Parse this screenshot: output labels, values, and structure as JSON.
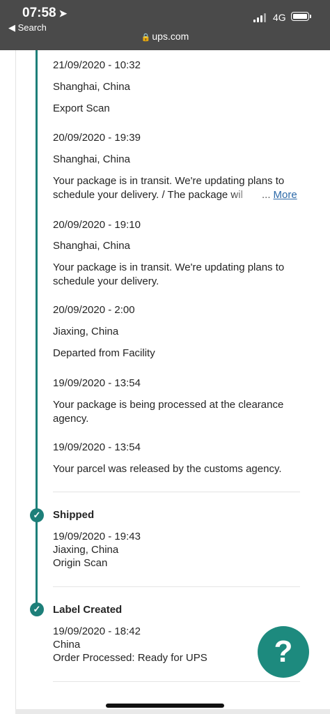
{
  "status": {
    "time": "07:58",
    "back_label": "Search",
    "network": "4G"
  },
  "browser": {
    "url": "ups.com"
  },
  "events": [
    {
      "datetime": "21/09/2020 - 10:32",
      "location": "Shanghai, China",
      "desc": "Export Scan"
    },
    {
      "datetime": "20/09/2020 - 19:39",
      "location": "Shanghai, China",
      "desc": "Your package is in transit. We're updating plans to schedule your delivery. / The package wil",
      "more": "...",
      "more_link": "More"
    },
    {
      "datetime": "20/09/2020 - 19:10",
      "location": "Shanghai, China",
      "desc": "Your package is in transit. We're updating plans to schedule your delivery."
    },
    {
      "datetime": "20/09/2020 - 2:00",
      "location": "Jiaxing, China",
      "desc": "Departed from Facility"
    },
    {
      "datetime": "19/09/2020 - 13:54",
      "desc": "Your package is being processed at the clearance agency."
    },
    {
      "datetime": "19/09/2020 - 13:54",
      "desc": "Your parcel was released by the customs agency."
    }
  ],
  "milestones": [
    {
      "title": "Shipped",
      "datetime": "19/09/2020 - 19:43",
      "location": "Jiaxing, China",
      "desc": "Origin Scan"
    },
    {
      "title": "Label Created",
      "datetime": "19/09/2020 - 18:42",
      "location": "China",
      "desc": "Order Processed: Ready for UPS"
    }
  ],
  "help_button": {
    "label": "?"
  },
  "colors": {
    "accent": "#1d7f79",
    "link": "#2c69a8",
    "topbar": "#4a4a4a"
  }
}
